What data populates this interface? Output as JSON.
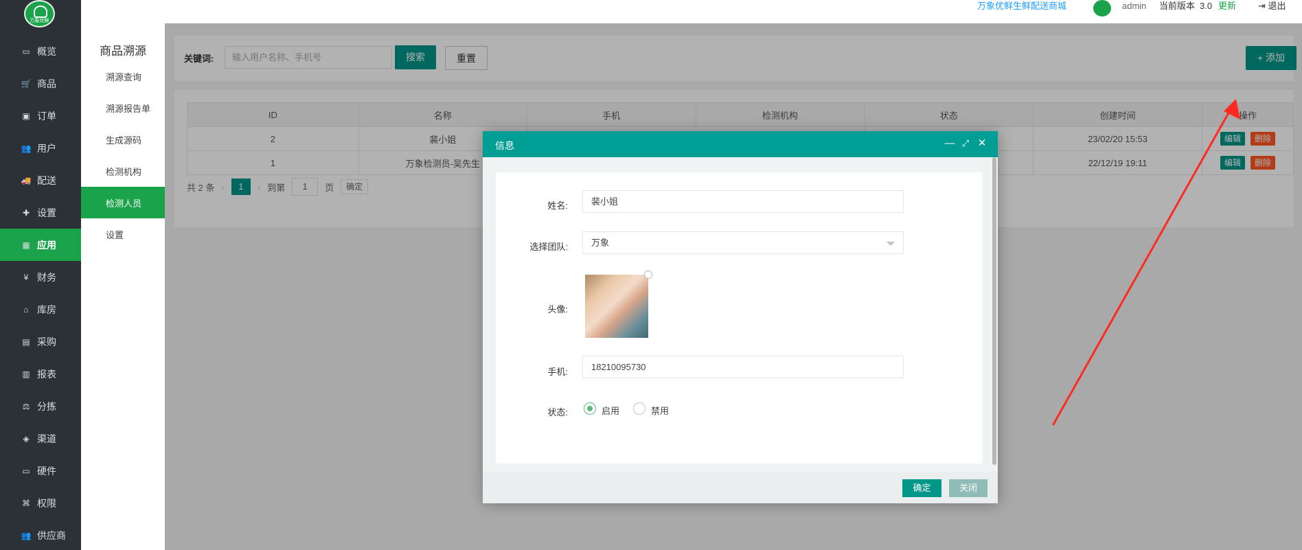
{
  "header": {
    "shop_name": "万象优鲜生鲜配送商城",
    "username": "admin",
    "version_label": "当前版本",
    "version": "3.0",
    "update_label": "更新",
    "logout_label": "退出",
    "logo_text": "万象优鲜"
  },
  "nav": [
    {
      "label": "概览",
      "icon": "monitor-icon"
    },
    {
      "label": "商品",
      "icon": "cart-icon"
    },
    {
      "label": "订单",
      "icon": "money-icon"
    },
    {
      "label": "用户",
      "icon": "users-icon"
    },
    {
      "label": "配送",
      "icon": "truck-icon"
    },
    {
      "label": "设置",
      "icon": "settings-icon"
    },
    {
      "label": "应用",
      "icon": "apps-icon",
      "active": true
    },
    {
      "label": "财务",
      "icon": "yen-icon"
    },
    {
      "label": "库房",
      "icon": "home-icon"
    },
    {
      "label": "采购",
      "icon": "bus-icon"
    },
    {
      "label": "报表",
      "icon": "bar-chart-icon"
    },
    {
      "label": "分拣",
      "icon": "scale-icon"
    },
    {
      "label": "渠道",
      "icon": "cube-icon"
    },
    {
      "label": "硬件",
      "icon": "desktop-icon"
    },
    {
      "label": "权限",
      "icon": "bank-icon"
    },
    {
      "label": "供应商",
      "icon": "group-icon"
    }
  ],
  "subnav": {
    "title": "商品溯源",
    "items": [
      "溯源查询",
      "溯源报告单",
      "生成源码",
      "检测机构",
      "检测人员",
      "设置"
    ],
    "active_index": 4
  },
  "search": {
    "keyword_label": "关键词:",
    "placeholder": "输入用户名称、手机号",
    "search_label": "搜索",
    "reset_label": "重置",
    "add_label": "+ 添加"
  },
  "table": {
    "columns": [
      "ID",
      "名称",
      "手机",
      "检测机构",
      "状态",
      "创建时间",
      "操作"
    ],
    "rows": [
      {
        "id": "2",
        "name": "裴小姐",
        "phone": "",
        "org": "",
        "status": "",
        "created": "23/02/20 15:53"
      },
      {
        "id": "1",
        "name": "万象检测员-吴先生",
        "phone": "",
        "org": "",
        "status": "",
        "created": "22/12/19 19:11"
      }
    ],
    "edit_label": "编辑",
    "delete_label": "删除"
  },
  "pager": {
    "total": "共 2 条",
    "current": "1",
    "goto_label": "到第",
    "page_input": "1",
    "page_unit": "页",
    "confirm_label": "确定"
  },
  "dialog": {
    "title": "信息",
    "name_label": "姓名:",
    "name_value": "裴小姐",
    "team_label": "选择团队:",
    "team_value": "万象",
    "avatar_label": "头像:",
    "phone_label": "手机:",
    "phone_value": "18210095730",
    "status_label": "状态:",
    "status_enabled": "启用",
    "status_disabled": "禁用",
    "ok_label": "确定",
    "close_label": "关闭"
  },
  "colors": {
    "nav_bg": "#2b3137",
    "brand_green": "#1aa34a",
    "teal": "#009688",
    "danger": "#ff5722",
    "annotation": "#ff2a1f"
  }
}
